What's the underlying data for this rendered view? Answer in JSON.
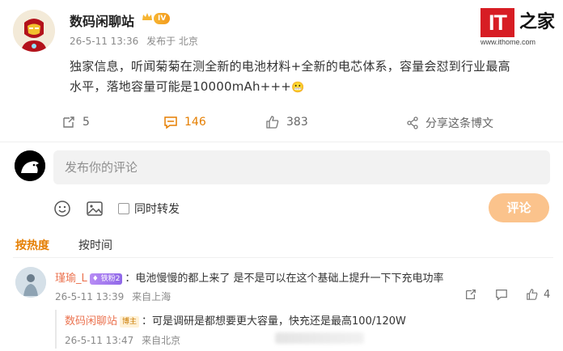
{
  "post": {
    "author": "数码闲聊站",
    "level_badge": "IV",
    "time": "26-5-11 13:36",
    "source": "发布于 北京",
    "content_line1": "独家信息，听闻菊菊在测全新的电池材料+全新的电芯体系，容量会怼到行业最高",
    "content_line2": "水平，落地容量可能是10000mAh+++",
    "emoji": "😬",
    "actions": {
      "repost_count": "5",
      "comment_count": "146",
      "like_count": "383",
      "share_label": "分享这条博文"
    }
  },
  "watermark": {
    "logo_text": "IT",
    "logo_char": "之家",
    "url": "www.ithome.com"
  },
  "composer": {
    "placeholder": "发布你的评论",
    "repost_label": "同时转发",
    "submit_label": "评论"
  },
  "sort": {
    "hot": "按热度",
    "time": "按时间"
  },
  "comment": {
    "user": "瑾瑜_L",
    "badge": "铁粉2",
    "text": "：电池慢慢的都上来了 是不是可以在这个基础上提升一下下充电功率",
    "time": "26-5-11 13:39",
    "source": "来自上海",
    "like_count": "4"
  },
  "reply": {
    "user": "数码闲聊站",
    "badge": "博主",
    "text": "：可是调研是都想要更大容量，快充还是最高100/120W",
    "time": "26-5-11 13:47",
    "source": "来自北京"
  },
  "colors": {
    "accent": "#e57e00",
    "username": "#eb7350",
    "submit_disabled": "#fbc38c",
    "watermark_red": "#d71d24"
  }
}
